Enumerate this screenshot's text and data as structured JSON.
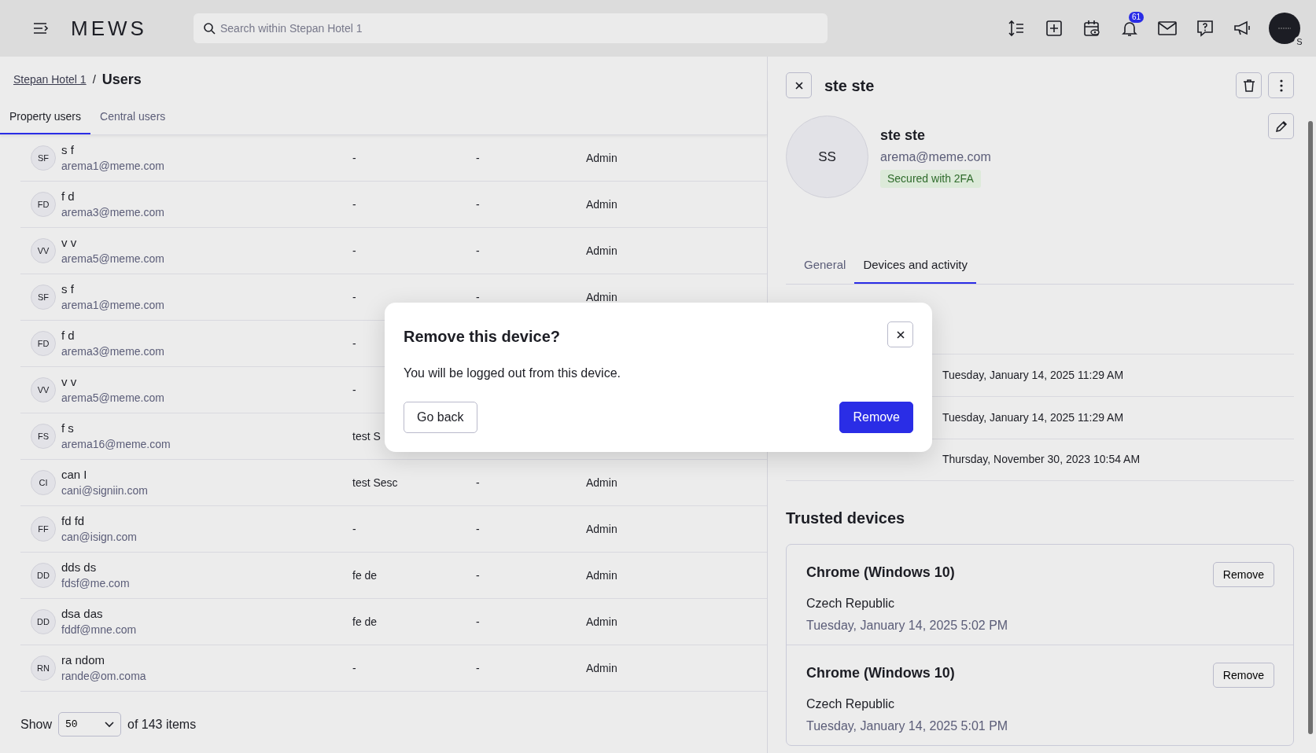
{
  "topbar": {
    "logo": "MEWS",
    "search": {
      "placeholder": "Search within Stepan Hotel 1"
    },
    "notification_count": "61",
    "avatar_badge": "S"
  },
  "breadcrumb": {
    "link": "Stepan Hotel 1",
    "separator": "/",
    "current": "Users"
  },
  "tabs": [
    {
      "label": "Property users",
      "selected": true
    },
    {
      "label": "Central users",
      "selected": false
    }
  ],
  "users": [
    {
      "initials": "SF",
      "name": "s f",
      "email": "arema1@meme.com",
      "column_2": "-",
      "column_3": "-",
      "role": "Admin"
    },
    {
      "initials": "FD",
      "name": "f d",
      "email": "arema3@meme.com",
      "column_2": "-",
      "column_3": "-",
      "role": "Admin"
    },
    {
      "initials": "VV",
      "name": "v v",
      "email": "arema5@meme.com",
      "column_2": "-",
      "column_3": "-",
      "role": "Admin"
    },
    {
      "initials": "SF",
      "name": "s f",
      "email": "arema1@meme.com",
      "column_2": "-",
      "column_3": "-",
      "role": "Admin"
    },
    {
      "initials": "FD",
      "name": "f d",
      "email": "arema3@meme.com",
      "column_2": "-"
    },
    {
      "initials": "VV",
      "name": "v v",
      "email": "arema5@meme.com",
      "column_2": "-"
    },
    {
      "initials": "FS",
      "name": "f s",
      "email": "arema16@meme.com",
      "column_2": "test S"
    },
    {
      "initials": "CI",
      "name": "can I",
      "email": "cani@signiin.com",
      "column_2": "test Sesc",
      "column_3": "-",
      "role": "Admin"
    },
    {
      "initials": "FF",
      "name": "fd fd",
      "email": "can@isign.com",
      "column_2": "-",
      "column_3": "-",
      "role": "Admin"
    },
    {
      "initials": "DD",
      "name": "dds ds",
      "email": "fdsf@me.com",
      "column_2": "fe de",
      "column_3": "-",
      "role": "Admin"
    },
    {
      "initials": "DD",
      "name": "dsa das",
      "email": "fddf@mne.com",
      "column_2": "fe de",
      "column_3": "-",
      "role": "Admin"
    },
    {
      "initials": "RN",
      "name": "ra ndom",
      "email": "rande@om.coma",
      "column_2": "-",
      "column_3": "-",
      "role": "Admin"
    }
  ],
  "pagination": {
    "label": "Show",
    "page_size": "50",
    "total": "of 143 items"
  },
  "detail": {
    "title": "ste ste",
    "avatar": "SS",
    "name": "ste ste",
    "email": "arema@meme.com",
    "badge": "Secured with 2FA",
    "tabs": [
      {
        "label": "General",
        "selected": false
      },
      {
        "label": "Devices and activity",
        "selected": true
      }
    ],
    "activity": [
      {
        "value": "Tuesday, January 14, 2025 11:29 AM"
      },
      {
        "value": "Tuesday, January 14, 2025 11:29 AM"
      },
      {
        "value": "Thursday, November 30, 2023 10:54 AM"
      }
    ],
    "trusted_devices": {
      "title": "Trusted devices",
      "devices": [
        {
          "name": "Chrome (Windows 10)",
          "location": "Czech Republic",
          "date": "Tuesday, January 14, 2025 5:02 PM",
          "action": "Remove"
        },
        {
          "name": "Chrome (Windows 10)",
          "location": "Czech Republic",
          "date": "Tuesday, January 14, 2025 5:01 PM",
          "action": "Remove"
        }
      ]
    }
  },
  "modal": {
    "title": "Remove this device?",
    "message": "You will be logged out from this device.",
    "buttons": [
      {
        "label": "Go back",
        "kind": "secondary"
      },
      {
        "label": "Remove",
        "kind": "primary"
      }
    ]
  }
}
